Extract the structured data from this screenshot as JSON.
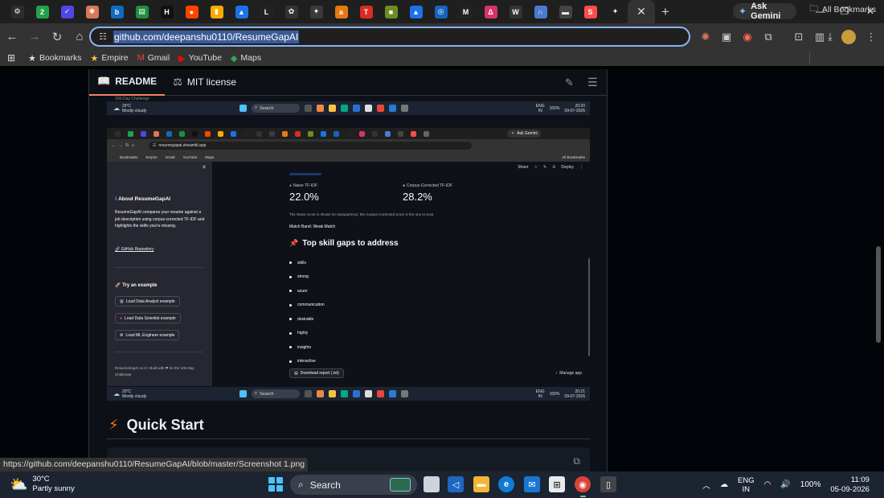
{
  "browser": {
    "tabs": [
      {
        "icon": "chatgpt-icon",
        "glyph": "⚙",
        "color": "#2d2d2d"
      },
      {
        "icon": "badge-2-icon",
        "glyph": "2",
        "color": "#22a34a"
      },
      {
        "icon": "check-icon",
        "glyph": "✓",
        "color": "#4f46e5"
      },
      {
        "icon": "claude-icon",
        "glyph": "✺",
        "color": "#d97757"
      },
      {
        "icon": "bing-icon",
        "glyph": "b",
        "color": "#0f6cbd"
      },
      {
        "icon": "sheets-icon",
        "glyph": "▤",
        "color": "#1e8e3e"
      },
      {
        "icon": "hackerrank-icon",
        "glyph": "H",
        "color": "#111111"
      },
      {
        "icon": "reddit-icon",
        "glyph": "●",
        "color": "#ff4500"
      },
      {
        "icon": "analytics-icon",
        "glyph": "▮",
        "color": "#f9ab00"
      },
      {
        "icon": "chart-icon",
        "glyph": "▲",
        "color": "#1a73e8"
      },
      {
        "icon": "letter-l-icon",
        "glyph": "L",
        "color": "#222222"
      },
      {
        "icon": "openai-icon",
        "glyph": "✿",
        "color": "#333333"
      },
      {
        "icon": "compass-icon",
        "glyph": "✦",
        "color": "#3a3a3a"
      },
      {
        "icon": "amazon-icon",
        "glyph": "a",
        "color": "#e47911"
      },
      {
        "icon": "toi-icon",
        "glyph": "T",
        "color": "#d92d20"
      },
      {
        "icon": "minecraft-icon",
        "glyph": "■",
        "color": "#6b8e23"
      },
      {
        "icon": "drive-icon",
        "glyph": "▲",
        "color": "#1a73e8"
      },
      {
        "icon": "square-icon",
        "glyph": "◎",
        "color": "#1565c0"
      },
      {
        "icon": "medium-icon",
        "glyph": "M",
        "color": "#222222"
      },
      {
        "icon": "delta-icon",
        "glyph": "Δ",
        "color": "#d6336c"
      },
      {
        "icon": "wikipedia-icon",
        "glyph": "W",
        "color": "#333333"
      },
      {
        "icon": "arch-icon",
        "glyph": "∩",
        "color": "#4a7bd0"
      },
      {
        "icon": "terminal-icon",
        "glyph": "▬",
        "color": "#444444"
      },
      {
        "icon": "streamlit-icon",
        "glyph": "S",
        "color": "#ff4b4b"
      },
      {
        "icon": "gemini-icon",
        "glyph": "✦",
        "color": "#1f1f1f"
      }
    ],
    "active_tab_close": "✕",
    "new_tab": "+",
    "ask_gemini": "Ask Gemini",
    "window_controls": [
      "—",
      "❐",
      "✕"
    ],
    "url": "github.com/deepanshu0110/ResumeGapAI",
    "bookmarks": [
      {
        "icon": "star-icon",
        "glyph": "★",
        "label": "Bookmarks"
      },
      {
        "icon": "star-icon",
        "glyph": "★",
        "label": "Empire"
      },
      {
        "icon": "gmail-icon",
        "glyph": "M",
        "label": "Gmail"
      },
      {
        "icon": "youtube-icon",
        "glyph": "▶",
        "label": "YouTube"
      },
      {
        "icon": "maps-icon",
        "glyph": "◆",
        "label": "Maps"
      }
    ],
    "all_bookmarks": "All Bookmarks"
  },
  "readme": {
    "tab_readme": "README",
    "tab_license": "MIT license",
    "quickstart_title": "Quick Start",
    "status_link": "https://github.com/deepanshu0110/ResumeGapAI/blob/master/Screenshot 1.png"
  },
  "screenshot": {
    "top_label": "100-Day Challenge",
    "top_taskbar": {
      "temp": "29°C",
      "weather": "Mostly cloudy",
      "search": "Search",
      "lang": "ENG",
      "region": "IN",
      "battery": "100%",
      "time": "20:20",
      "date": "09-07-2026"
    },
    "bottom_taskbar": {
      "temp": "29°C",
      "weather": "Mostly cloudy",
      "search": "Search",
      "lang": "ENG",
      "region": "IN",
      "battery": "100%",
      "time": "20:21",
      "date": "09-07-2026"
    },
    "inner_url": "resumegapai.streamlit.app",
    "inner_ask_gemini": "Ask Gemini",
    "inner_bookmarks": [
      "Bookmarks",
      "Empire",
      "Gmail",
      "YouTube",
      "Maps"
    ],
    "inner_all_bookmarks": "All Bookmarks",
    "sidebar": {
      "about_title": "About ResumeGapAI",
      "about_body": "ResumeGapAI compares your resume against a job description using corpus-corrected TF-IDF and highlights the skills you're missing.",
      "github_link": "GitHub Repository",
      "try_title": "Try an example",
      "buttons": [
        "Load Data Analyst example",
        "Load Data Scientist example",
        "Load ML Engineer example"
      ],
      "footer": "ResumeGapAI v1.0 • Built with ❤ for the 100-Day Challenge"
    },
    "main": {
      "header_actions": [
        "Share",
        "☆",
        "✎",
        "⊙",
        "Deploy",
        "⋮"
      ],
      "metric_naive_label": "Naive TF-IDF",
      "metric_naive_value": "22.0%",
      "metric_corpus_label": "Corpus-Corrected TF-IDF",
      "metric_corpus_value": "28.2%",
      "note": "The Naive score is shown for transparency; the Corpus-Corrected score is the one to trust.",
      "match_band": "Match Band: Weak Match",
      "gaps_title": "Top skill gaps to address",
      "gaps": [
        "skills",
        "strong",
        "azure",
        "communication",
        "desirable",
        "highly",
        "insights",
        "interactive"
      ],
      "download": "Download report (.txt)",
      "manage_app": "Manage app"
    }
  },
  "taskbar": {
    "temp": "30°C",
    "weather": "Partly sunny",
    "search": "Search",
    "lang": "ENG",
    "region": "IN",
    "battery": "100%",
    "time": "11:09",
    "date": "05-09-2026"
  }
}
